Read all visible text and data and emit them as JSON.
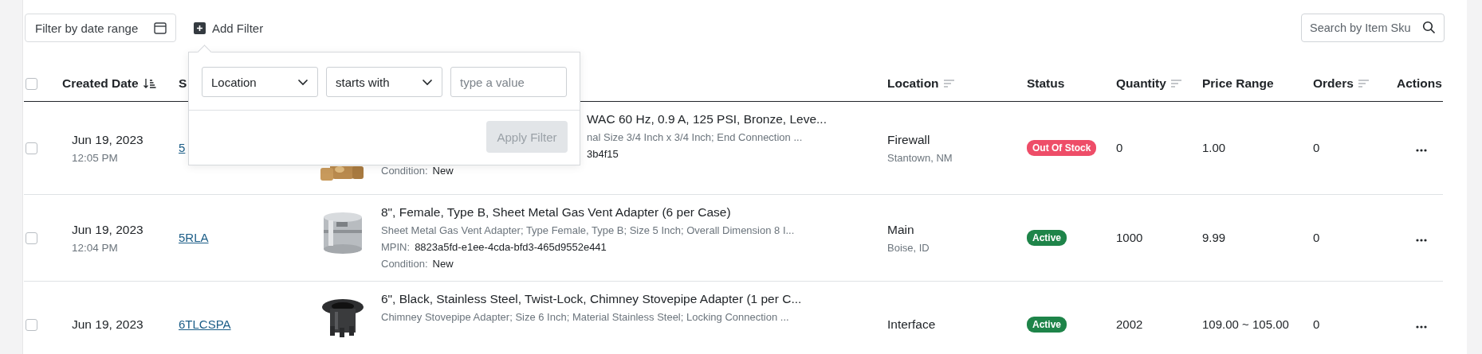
{
  "toolbar": {
    "date_filter": {
      "placeholder": "Filter by date range"
    },
    "add_filter": {
      "label": "Add Filter"
    },
    "search": {
      "placeholder": "Search by Item Sku"
    }
  },
  "filter_popover": {
    "field": {
      "value": "Location"
    },
    "operator": {
      "value": "starts with"
    },
    "value": {
      "placeholder": "type a value"
    },
    "apply_button": {
      "label": "Apply Filter",
      "disabled": true
    }
  },
  "table": {
    "select_all": {
      "checked": false
    },
    "columns": [
      {
        "label": "Created Date"
      },
      {
        "label": "S"
      },
      {
        "label": "Location"
      },
      {
        "label": "Status"
      },
      {
        "label": "Quantity"
      },
      {
        "label": "Price Range"
      },
      {
        "label": "Orders"
      },
      {
        "label": "Actions"
      }
    ],
    "rows": [
      {
        "checked": false,
        "date": "Jun 19, 2023",
        "time": "12:05 PM",
        "sku": "5",
        "title": "WAC 60 Hz, 0.9 A, 125 PSI, Bronze, Leve...",
        "description": "nal Size 3/4 Inch x 3/4 Inch; End Connection ...",
        "mpin": {
          "value": "3b4f15"
        },
        "condition": {
          "label": "Condition:",
          "value": "New"
        },
        "location": "Firewall",
        "city": "Stantown, NM",
        "status": {
          "label": "Out Of Stock",
          "kind": "out_of_stock"
        },
        "quantity": "0",
        "price": "1.00",
        "orders": "0"
      },
      {
        "checked": false,
        "date": "Jun 19, 2023",
        "time": "12:04 PM",
        "sku": "5RLA",
        "title": "8\", Female, Type B, Sheet Metal Gas Vent Adapter (6 per Case)",
        "description": "Sheet Metal Gas Vent Adapter; Type Female, Type B; Size 5 Inch; Overall Dimension 8 I...",
        "mpin": {
          "label": "MPIN:",
          "value": "8823a5fd-e1ee-4cda-bfd3-465d9552e441"
        },
        "condition": {
          "label": "Condition:",
          "value": "New"
        },
        "location": "Main",
        "city": "Boise, ID",
        "status": {
          "label": "Active",
          "kind": "active"
        },
        "quantity": "1000",
        "price": "9.99",
        "orders": "0"
      },
      {
        "checked": false,
        "date": "Jun 19, 2023",
        "sku": "6TLCSPA",
        "title": "6\", Black, Stainless Steel, Twist-Lock, Chimney Stovepipe Adapter (1 per C...",
        "description": "Chimney Stovepipe Adapter; Size 6 Inch; Material Stainless Steel; Locking Connection ...",
        "location": "Interface",
        "status": {
          "label": "Active",
          "kind": "active"
        },
        "quantity": "2002",
        "price": "109.00 ~ 105.00",
        "orders": "0"
      }
    ]
  }
}
